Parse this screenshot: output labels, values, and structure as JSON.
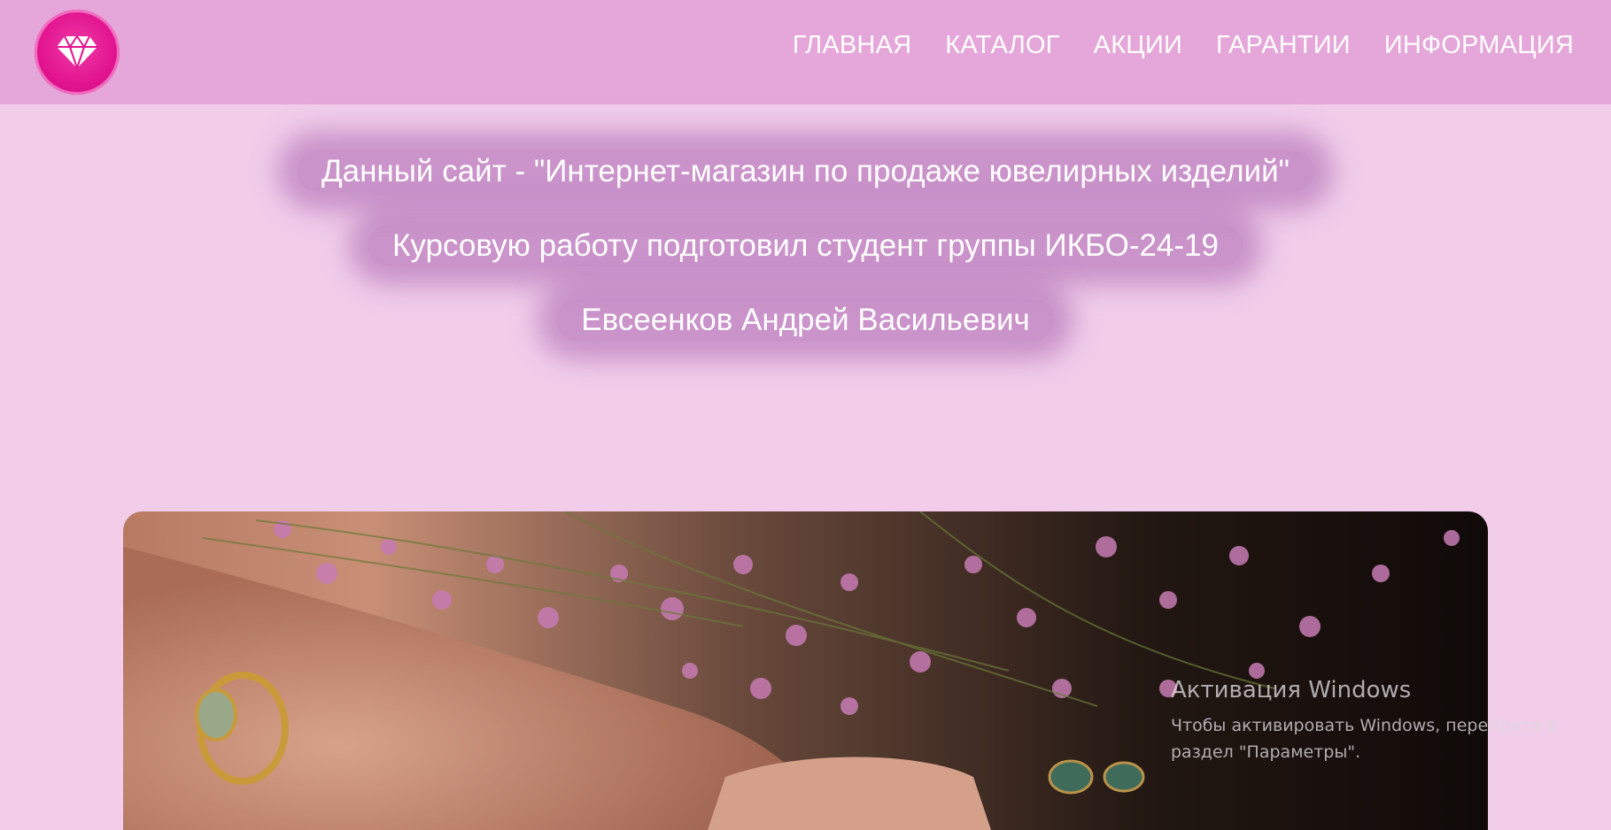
{
  "header": {
    "logo_icon": "diamond-icon",
    "nav": [
      {
        "label": "ГЛАВНАЯ"
      },
      {
        "label": "КАТАЛОГ"
      },
      {
        "label": "АКЦИИ"
      },
      {
        "label": "ГАРАНТИИ"
      },
      {
        "label": "ИНФОРМАЦИЯ"
      }
    ]
  },
  "info": {
    "line1": "Данный сайт - \"Интернет-магазин по продаже ювелирных изделий\"",
    "line2": "Курсовую работу подготовил студент группы ИКБО-24-19",
    "line3": "Евсеенков Андрей Васильевич"
  },
  "banner": {
    "image": "jewelry-with-flowers-photo"
  },
  "watermark": {
    "title": "Активация Windows",
    "subtitle": "Чтобы активировать Windows, перейдите в раздел \"Параметры\"."
  },
  "colors": {
    "header_bg": "#e5a6d9",
    "page_bg": "#f1cdea",
    "logo": "#e2138f"
  }
}
